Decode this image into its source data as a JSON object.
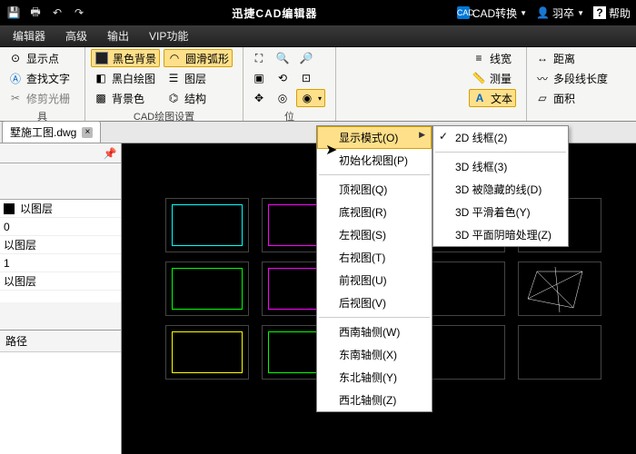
{
  "title": "迅捷CAD编辑器",
  "titlebar_right": {
    "convert": "CAD转换",
    "user": "羽卒",
    "help": "帮助"
  },
  "menu": [
    "编辑器",
    "高级",
    "输出",
    "VIP功能"
  ],
  "ribbon": {
    "g1": {
      "items": [
        "显示点",
        "查找文字",
        "修剪光栅"
      ],
      "label": "具"
    },
    "g2": {
      "col1": [
        "黑色背景",
        "黑白绘图",
        "背景色"
      ],
      "col2": [
        "圆滑弧形",
        "图层",
        "结构"
      ],
      "label": "CAD绘图设置"
    },
    "g3": {
      "label": "位"
    },
    "g4": {
      "items": [
        "线宽",
        "测量",
        "文本"
      ]
    },
    "g5": {
      "items": [
        "距离",
        "多段线长度",
        "面积"
      ]
    }
  },
  "tab": {
    "name": "墅施工图.dwg"
  },
  "layers": [
    {
      "swatch": "#000000",
      "name": "以图层"
    },
    {
      "swatch": null,
      "name": "0"
    },
    {
      "swatch": null,
      "name": "以图层"
    },
    {
      "swatch": null,
      "name": "1"
    },
    {
      "swatch": null,
      "name": "以图层"
    }
  ],
  "path_label": "路径",
  "popup_view": [
    "显示模式(O)",
    "初始化视图(P)",
    "顶视图(Q)",
    "底视图(R)",
    "左视图(S)",
    "右视图(T)",
    "前视图(U)",
    "后视图(V)",
    "西南轴侧(W)",
    "东南轴侧(X)",
    "东北轴侧(Y)",
    "西北轴侧(Z)"
  ],
  "popup_disp": [
    "2D 线框(2)",
    "3D 线框(3)",
    "3D 被隐藏的线(D)",
    "3D 平滑着色(Y)",
    "3D 平面阴暗处理(Z)"
  ]
}
